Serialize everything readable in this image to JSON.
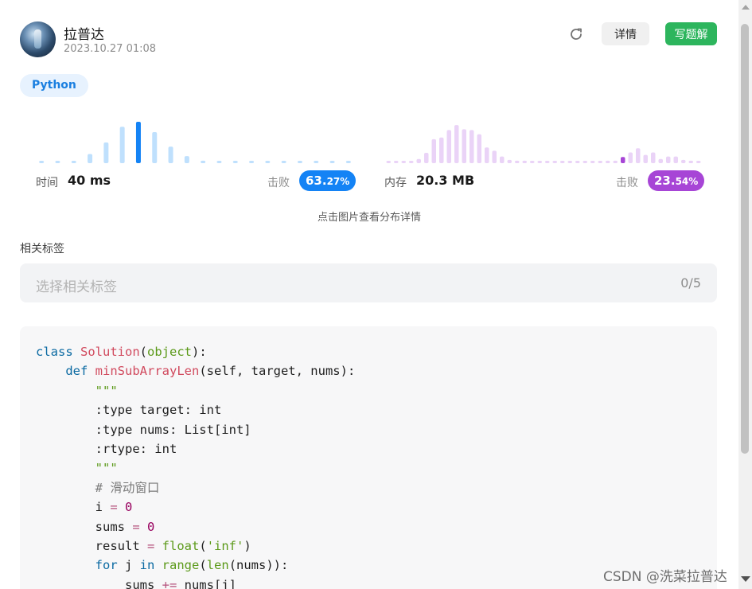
{
  "header": {
    "username": "拉普达",
    "datetime": "2023.10.27 01:08",
    "detail_button": "详情",
    "solution_button": "写题解"
  },
  "language_tag": "Python",
  "runtime": {
    "label": "时间",
    "value": "40 ms",
    "beat_label": "击败",
    "beat_main": "63.",
    "beat_small": "27%",
    "color": "#1483f5",
    "light_color": "#bfe0fd",
    "distribution": [
      0.04,
      0.04,
      0.04,
      0.22,
      0.5,
      0.88,
      1.0,
      0.75,
      0.4,
      0.17,
      0.06,
      0.04,
      0.04,
      0.04,
      0.04,
      0.04,
      0.04,
      0.04,
      0.04,
      0.04
    ],
    "highlight_index": 6
  },
  "memory": {
    "label": "内存",
    "value": "20.3 MB",
    "beat_label": "击败",
    "beat_main": "23.",
    "beat_small": "54%",
    "color": "#a745d6",
    "light_color": "#ead3f7",
    "distribution": [
      0.04,
      0.04,
      0.04,
      0.04,
      0.1,
      0.25,
      0.58,
      0.62,
      0.8,
      0.92,
      0.82,
      0.8,
      0.7,
      0.38,
      0.3,
      0.16,
      0.08,
      0.06,
      0.06,
      0.04,
      0.04,
      0.04,
      0.04,
      0.04,
      0.04,
      0.04,
      0.04,
      0.04,
      0.04,
      0.06,
      0.06,
      0.15,
      0.26,
      0.36,
      0.2,
      0.26,
      0.1,
      0.16,
      0.16,
      0.08,
      0.06,
      0.04
    ],
    "highlight_index": 31
  },
  "hint": "点击图片查看分布详情",
  "tags": {
    "title": "相关标签",
    "placeholder": "选择相关标签",
    "count": "0/5"
  },
  "watermark": "CSDN @洗菜拉普达"
}
